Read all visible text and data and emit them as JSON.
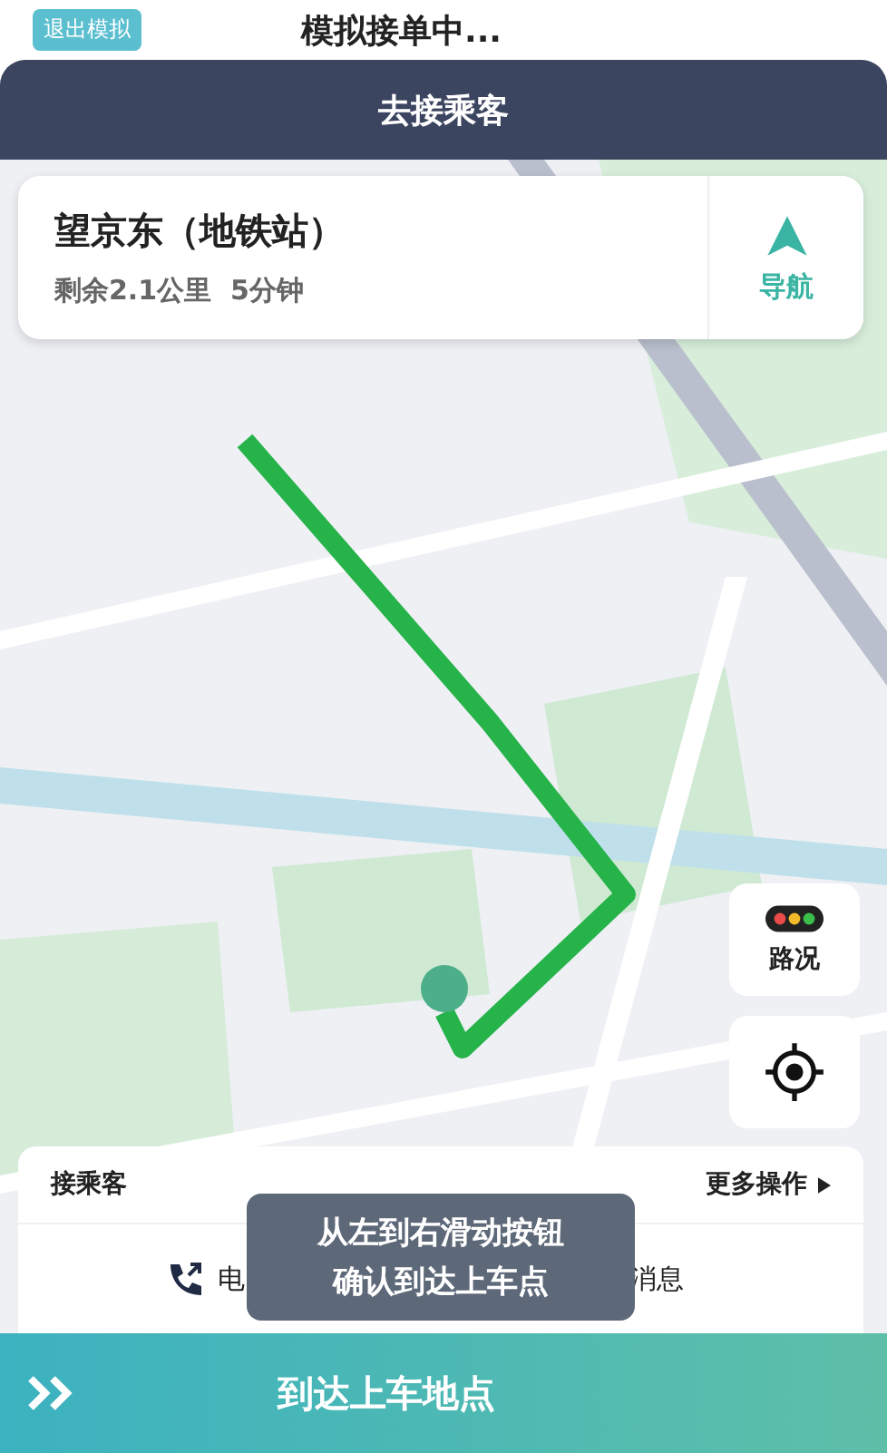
{
  "top_bar": {
    "exit_button": "退出模拟",
    "title": "模拟接单中..."
  },
  "header": {
    "title": "去接乘客"
  },
  "destination_card": {
    "name": "望京东（地铁站）",
    "remaining": "剩余2.1公里  5分钟",
    "nav_label": "导航"
  },
  "map_controls": {
    "traffic_label": "路况"
  },
  "passenger_panel": {
    "title": "接乘客",
    "more": "更多操作",
    "call_label": "电",
    "message_label": "消息"
  },
  "tooltip": {
    "lines": [
      "从左到右滑动按钮",
      "确认到达上车点"
    ]
  },
  "slide_bar": {
    "label": "到达上车地点"
  }
}
